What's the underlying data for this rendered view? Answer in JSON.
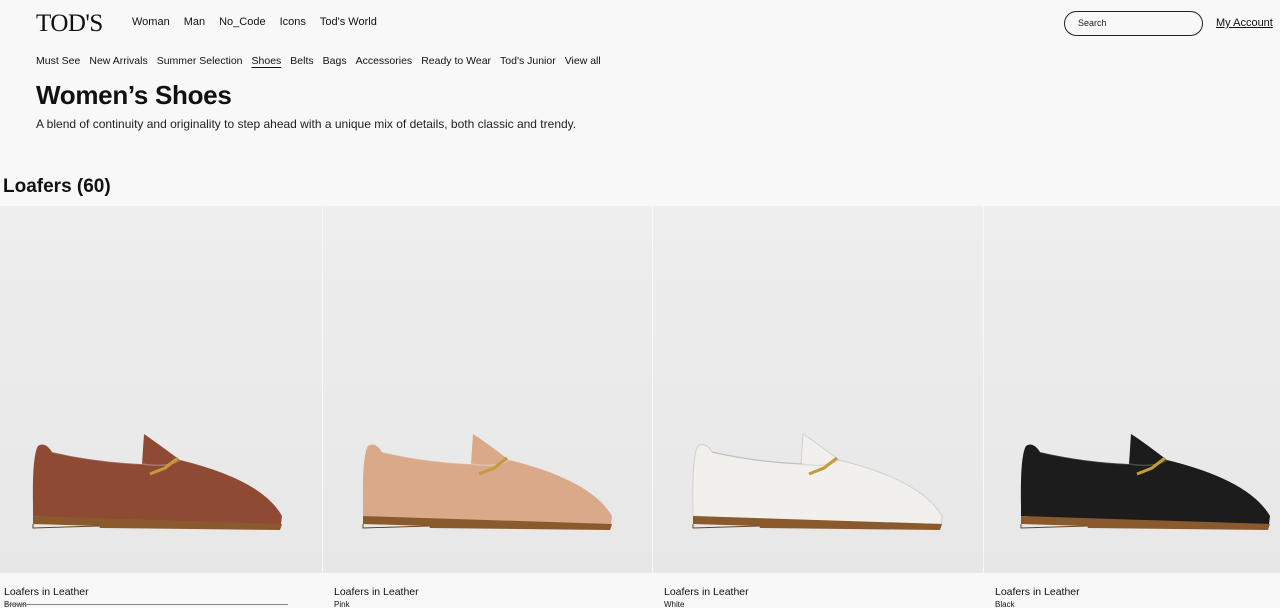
{
  "header": {
    "logo": "TOD'S",
    "nav": [
      "Woman",
      "Man",
      "No_Code",
      "Icons",
      "Tod's World"
    ],
    "search_placeholder": "Search",
    "account": "My Account"
  },
  "subnav": {
    "items": [
      "Must See",
      "New Arrivals",
      "Summer Selection",
      "Shoes",
      "Belts",
      "Bags",
      "Accessories",
      "Ready to Wear",
      "Tod's Junior",
      "View all"
    ],
    "active": "Shoes"
  },
  "page": {
    "title": "Women’s Shoes",
    "description": "A blend of continuity and originality to step ahead with a unique mix of details, both classic and trendy."
  },
  "category": {
    "title": "Loafers (60)"
  },
  "products": [
    {
      "name": "Loafers in Leather",
      "color": "Brown",
      "shoe_color": "#8e4a33"
    },
    {
      "name": "Loafers in Leather",
      "color": "Pink",
      "shoe_color": "#d9a98a"
    },
    {
      "name": "Loafers in Leather",
      "color": "White",
      "shoe_color": "#f1f0ec"
    },
    {
      "name": "Loafers in Leather",
      "color": "Black",
      "shoe_color": "#1c1c1c"
    }
  ]
}
